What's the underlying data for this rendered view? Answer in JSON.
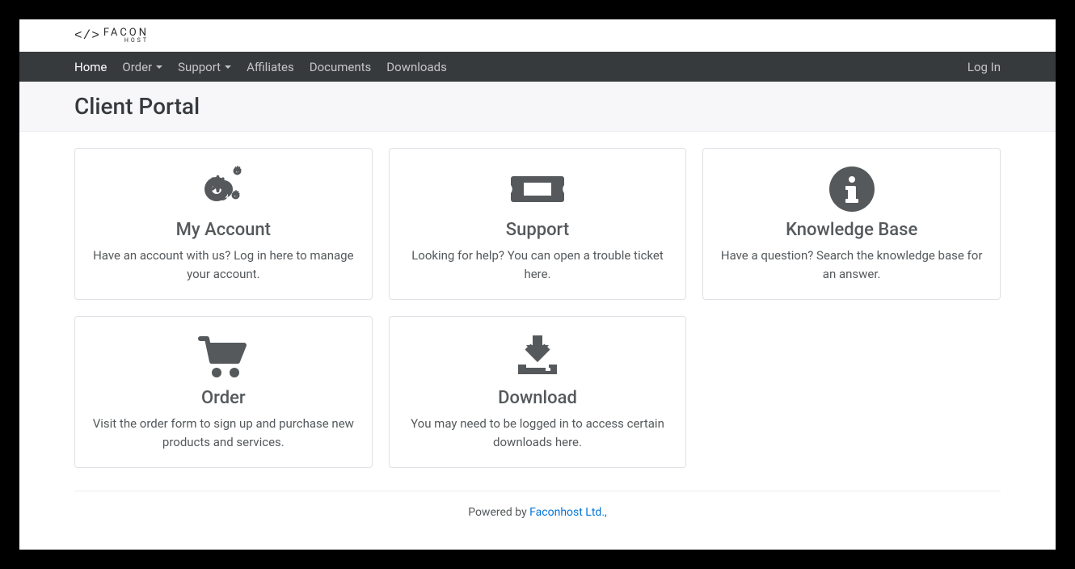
{
  "logo": {
    "icon": "</>",
    "main": "FACON",
    "sub": "HOST"
  },
  "nav": {
    "home": "Home",
    "order": "Order",
    "support": "Support",
    "affiliates": "Affiliates",
    "documents": "Documents",
    "downloads": "Downloads",
    "login": "Log In"
  },
  "page_title": "Client Portal",
  "cards": {
    "account": {
      "title": "My Account",
      "desc": "Have an account with us? Log in here to manage your account."
    },
    "support": {
      "title": "Support",
      "desc": "Looking for help? You can open a trouble ticket here."
    },
    "kb": {
      "title": "Knowledge Base",
      "desc": "Have a question? Search the knowledge base for an answer."
    },
    "order": {
      "title": "Order",
      "desc": "Visit the order form to sign up and purchase new products and services."
    },
    "download": {
      "title": "Download",
      "desc": "You may need to be logged in to access certain downloads here."
    }
  },
  "footer": {
    "prefix": "Powered by ",
    "link": "Faconhost Ltd.,"
  }
}
